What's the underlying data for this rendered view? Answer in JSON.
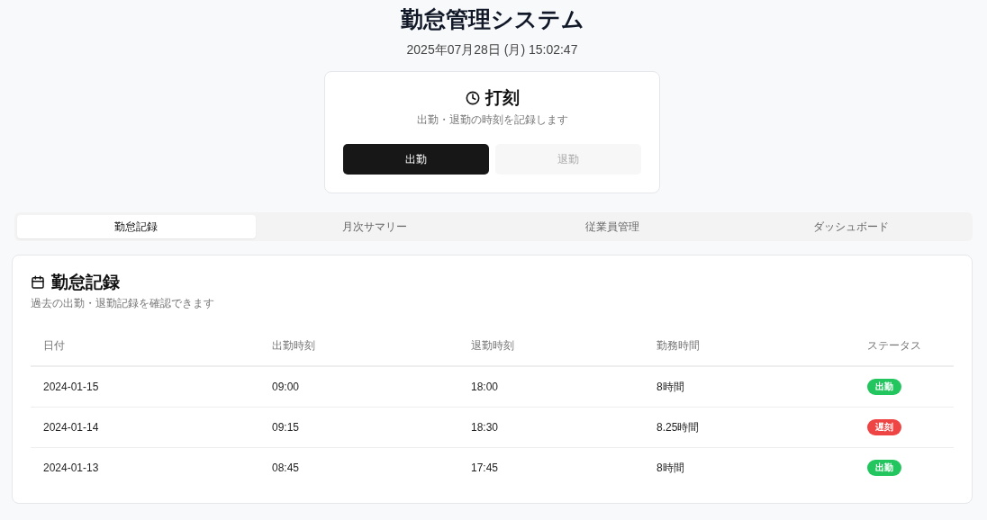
{
  "header": {
    "title": "勤怠管理システム",
    "datetime": "2025年07月28日 (月) 15:02:47"
  },
  "punch": {
    "title": "打刻",
    "description": "出勤・退勤の時刻を記録します",
    "buttons": [
      {
        "label": "出勤",
        "kind": "primary",
        "disabled": false
      },
      {
        "label": "退勤",
        "kind": "secondary",
        "disabled": true
      }
    ]
  },
  "tabs": [
    {
      "label": "勤怠記録",
      "selected": true
    },
    {
      "label": "月次サマリー",
      "selected": false
    },
    {
      "label": "従業員管理",
      "selected": false
    },
    {
      "label": "ダッシュボード",
      "selected": false
    }
  ],
  "records": {
    "title": "勤怠記録",
    "description": "過去の出勤・退勤記録を確認できます",
    "table": {
      "columns": [
        "日付",
        "出勤時刻",
        "退勤時刻",
        "勤務時間",
        "ステータス"
      ],
      "rows": [
        {
          "date": "2024-01-15",
          "clock_in": "09:00",
          "clock_out": "18:00",
          "hours": "8時間",
          "status": {
            "label": "出勤",
            "color": "#22c55e"
          }
        },
        {
          "date": "2024-01-14",
          "clock_in": "09:15",
          "clock_out": "18:30",
          "hours": "8.25時間",
          "status": {
            "label": "遅刻",
            "color": "#ef4444"
          }
        },
        {
          "date": "2024-01-13",
          "clock_in": "08:45",
          "clock_out": "17:45",
          "hours": "8時間",
          "status": {
            "label": "出勤",
            "color": "#22c55e"
          }
        }
      ]
    }
  }
}
